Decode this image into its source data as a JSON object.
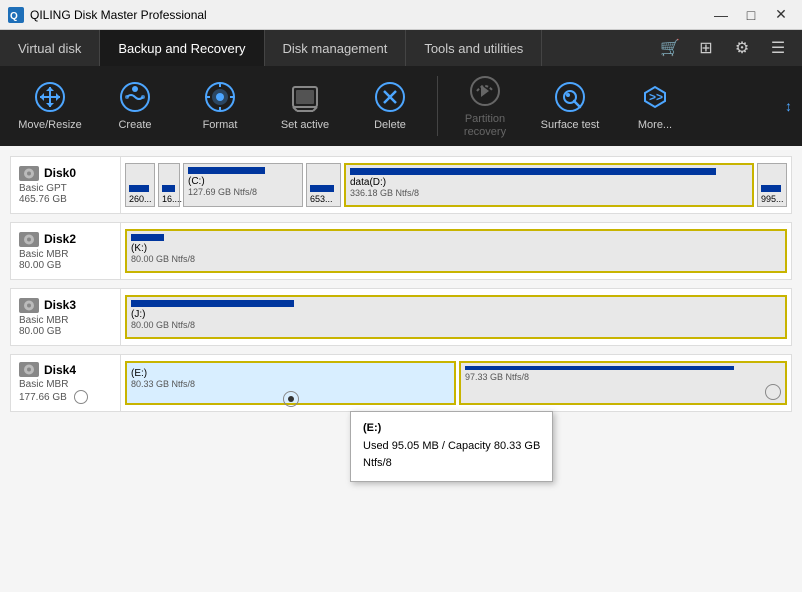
{
  "titleBar": {
    "title": "QILING Disk Master Professional",
    "minimizeLabel": "—",
    "maximizeLabel": "□",
    "closeLabel": "✕"
  },
  "mainTabs": [
    {
      "label": "Virtual disk",
      "active": false
    },
    {
      "label": "Backup and Recovery",
      "active": true
    },
    {
      "label": "Disk management",
      "active": false
    },
    {
      "label": "Tools and utilities",
      "active": false
    }
  ],
  "toolbar": {
    "items": [
      {
        "id": "move-resize",
        "label": "Move/Resize",
        "enabled": true
      },
      {
        "id": "create",
        "label": "Create",
        "enabled": true
      },
      {
        "id": "format",
        "label": "Format",
        "enabled": true
      },
      {
        "id": "set-active",
        "label": "Set active",
        "enabled": true
      },
      {
        "id": "delete",
        "label": "Delete",
        "enabled": true
      },
      {
        "id": "partition-recovery",
        "label": "Partition recovery",
        "enabled": false
      },
      {
        "id": "surface-test",
        "label": "Surface test",
        "enabled": true
      },
      {
        "id": "more",
        "label": "More...",
        "enabled": true
      }
    ]
  },
  "disks": [
    {
      "name": "Disk0",
      "type": "Basic GPT",
      "size": "465.76 GB",
      "partitions": [
        {
          "label": "260...",
          "size": "",
          "barWidth": "90%"
        },
        {
          "label": "16....",
          "size": "",
          "barWidth": "90%"
        },
        {
          "label": "(C:)",
          "size": "127.69 GB Ntfs/8",
          "barWidth": "70%"
        },
        {
          "label": "653...",
          "size": "",
          "barWidth": "90%"
        },
        {
          "label": "data(D:)",
          "size": "336.18 GB Ntfs/8",
          "barWidth": "92%"
        },
        {
          "label": "995...",
          "size": "",
          "barWidth": "90%"
        }
      ]
    },
    {
      "name": "Disk2",
      "type": "Basic MBR",
      "size": "80.00 GB",
      "partitions": [
        {
          "label": "(K:)",
          "size": "80.00 GB Ntfs/8",
          "barWidth": "5%"
        }
      ]
    },
    {
      "name": "Disk3",
      "type": "Basic MBR",
      "size": "80.00 GB",
      "partitions": [
        {
          "label": "(J:)",
          "size": "80.00 GB Ntfs/8",
          "barWidth": "25%"
        }
      ]
    },
    {
      "name": "Disk4",
      "type": "Basic MBR",
      "size": "177.66 GB",
      "partitions": [
        {
          "label": "(E:)",
          "size": "80.33 GB Ntfs/8",
          "barWidth": "5%"
        },
        {
          "label": "",
          "size": "97.33 GB Ntfs/8",
          "barWidth": "90%"
        }
      ],
      "tooltip": {
        "drive": "(E:)",
        "used": "Used 95.05 MB / Capacity 80.33 GB",
        "fs": "Ntfs/8"
      }
    }
  ]
}
